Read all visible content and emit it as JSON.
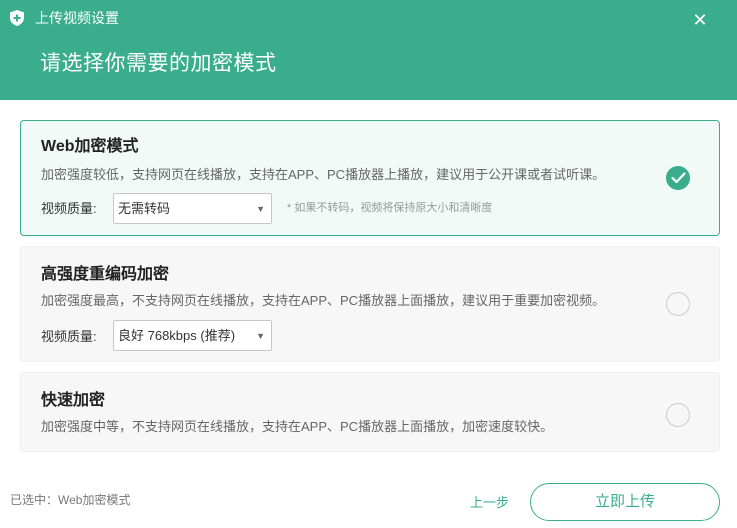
{
  "window": {
    "title": "上传视频设置",
    "heading": "请选择你需要的加密模式",
    "close_icon": "close-icon",
    "app_icon": "shield-plus-icon",
    "accent_color": "#3aae8c"
  },
  "options": [
    {
      "title": "Web加密模式",
      "description": "加密强度较低，支持网页在线播放，支持在APP、PC播放器上播放，建议用于公开课或者试听课。",
      "quality_label": "视频质量:",
      "quality_value": "无需转码",
      "quality_note": "* 如果不转码，视频将保持原大小和清晰度",
      "selected": true
    },
    {
      "title": "高强度重编码加密",
      "description": "加密强度最高，不支持网页在线播放，支持在APP、PC播放器上面播放，建议用于重要加密视频。",
      "quality_label": "视频质量:",
      "quality_value": "良好 768kbps (推荐)",
      "selected": false
    },
    {
      "title": "快速加密",
      "description": "加密强度中等，不支持网页在线播放，支持在APP、PC播放器上面播放，加密速度较快。",
      "selected": false
    }
  ],
  "footer": {
    "status": "已选中：Web加密模式",
    "prev_label": "上一步",
    "upload_label": "立即上传"
  }
}
